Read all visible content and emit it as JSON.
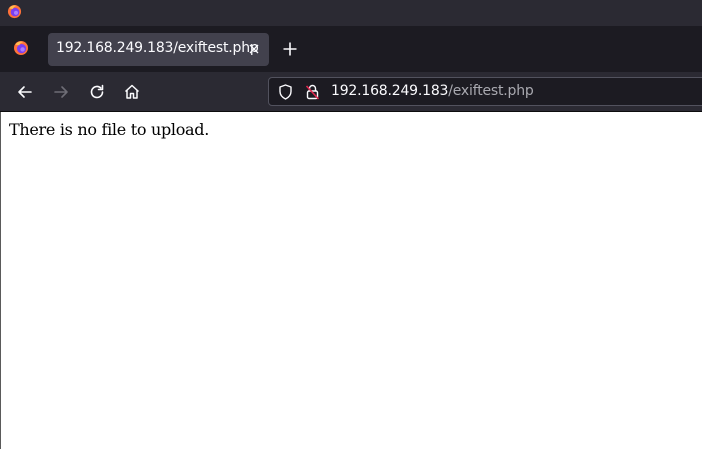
{
  "browser": {
    "app_icon": "firefox-icon",
    "tab": {
      "title": "192.168.249.183/exiftest.php",
      "close_icon": "close-icon"
    },
    "new_tab_icon": "plus-icon",
    "nav": {
      "back_icon": "arrow-left-icon",
      "forward_icon": "arrow-right-icon",
      "reload_icon": "reload-icon",
      "home_icon": "home-icon"
    },
    "urlbar": {
      "host": "192.168.249.183",
      "path": "/exiftest.php",
      "shield_icon": "shield-icon",
      "lock_icon": "insecure-lock-icon"
    },
    "colors": {
      "titlebar": "#2b2a33",
      "tabstrip": "#1c1b22",
      "active_tab": "#42414d",
      "urlbar": "#1c1b22",
      "url_path": "#a9a9b0"
    }
  },
  "page": {
    "message": "There is no file to upload."
  }
}
